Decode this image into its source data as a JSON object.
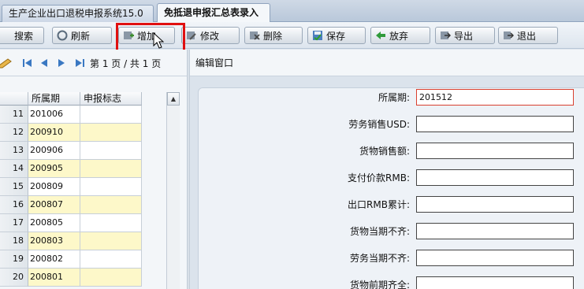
{
  "tabs": [
    {
      "label": "生产企业出口退税申报系统15.0"
    },
    {
      "label": "免抵退申报汇总表录入"
    }
  ],
  "toolbar": {
    "search": "搜索",
    "refresh": "刷新",
    "add": "增加",
    "edit": "修改",
    "delete": "删除",
    "save": "保存",
    "discard": "放弃",
    "export": "导出",
    "exit": "退出"
  },
  "pager": {
    "info": "第 1 页 / 共 1 页"
  },
  "grid": {
    "columns": [
      "所属期",
      "申报标志"
    ],
    "rows": [
      {
        "n": "11",
        "period": "201006",
        "flag": ""
      },
      {
        "n": "12",
        "period": "200910",
        "flag": ""
      },
      {
        "n": "13",
        "period": "200906",
        "flag": ""
      },
      {
        "n": "14",
        "period": "200905",
        "flag": ""
      },
      {
        "n": "15",
        "period": "200809",
        "flag": ""
      },
      {
        "n": "16",
        "period": "200807",
        "flag": ""
      },
      {
        "n": "17",
        "period": "200805",
        "flag": ""
      },
      {
        "n": "18",
        "period": "200803",
        "flag": ""
      },
      {
        "n": "19",
        "period": "200802",
        "flag": ""
      },
      {
        "n": "20",
        "period": "200801",
        "flag": ""
      }
    ]
  },
  "editor": {
    "title": "编辑窗口",
    "fields": [
      {
        "label": "所属期:",
        "value": "201512"
      },
      {
        "label": "劳务销售USD:",
        "value": ""
      },
      {
        "label": "货物销售额:",
        "value": ""
      },
      {
        "label": "支付价款RMB:",
        "value": ""
      },
      {
        "label": "出口RMB累计:",
        "value": ""
      },
      {
        "label": "货物当期不齐:",
        "value": ""
      },
      {
        "label": "劳务当期不齐:",
        "value": ""
      },
      {
        "label": "货物前期齐全:",
        "value": ""
      }
    ]
  },
  "colors": {
    "highlight_box": "#e01010",
    "active_field_border": "#d9402f",
    "alt_row": "#fdf8c9"
  }
}
